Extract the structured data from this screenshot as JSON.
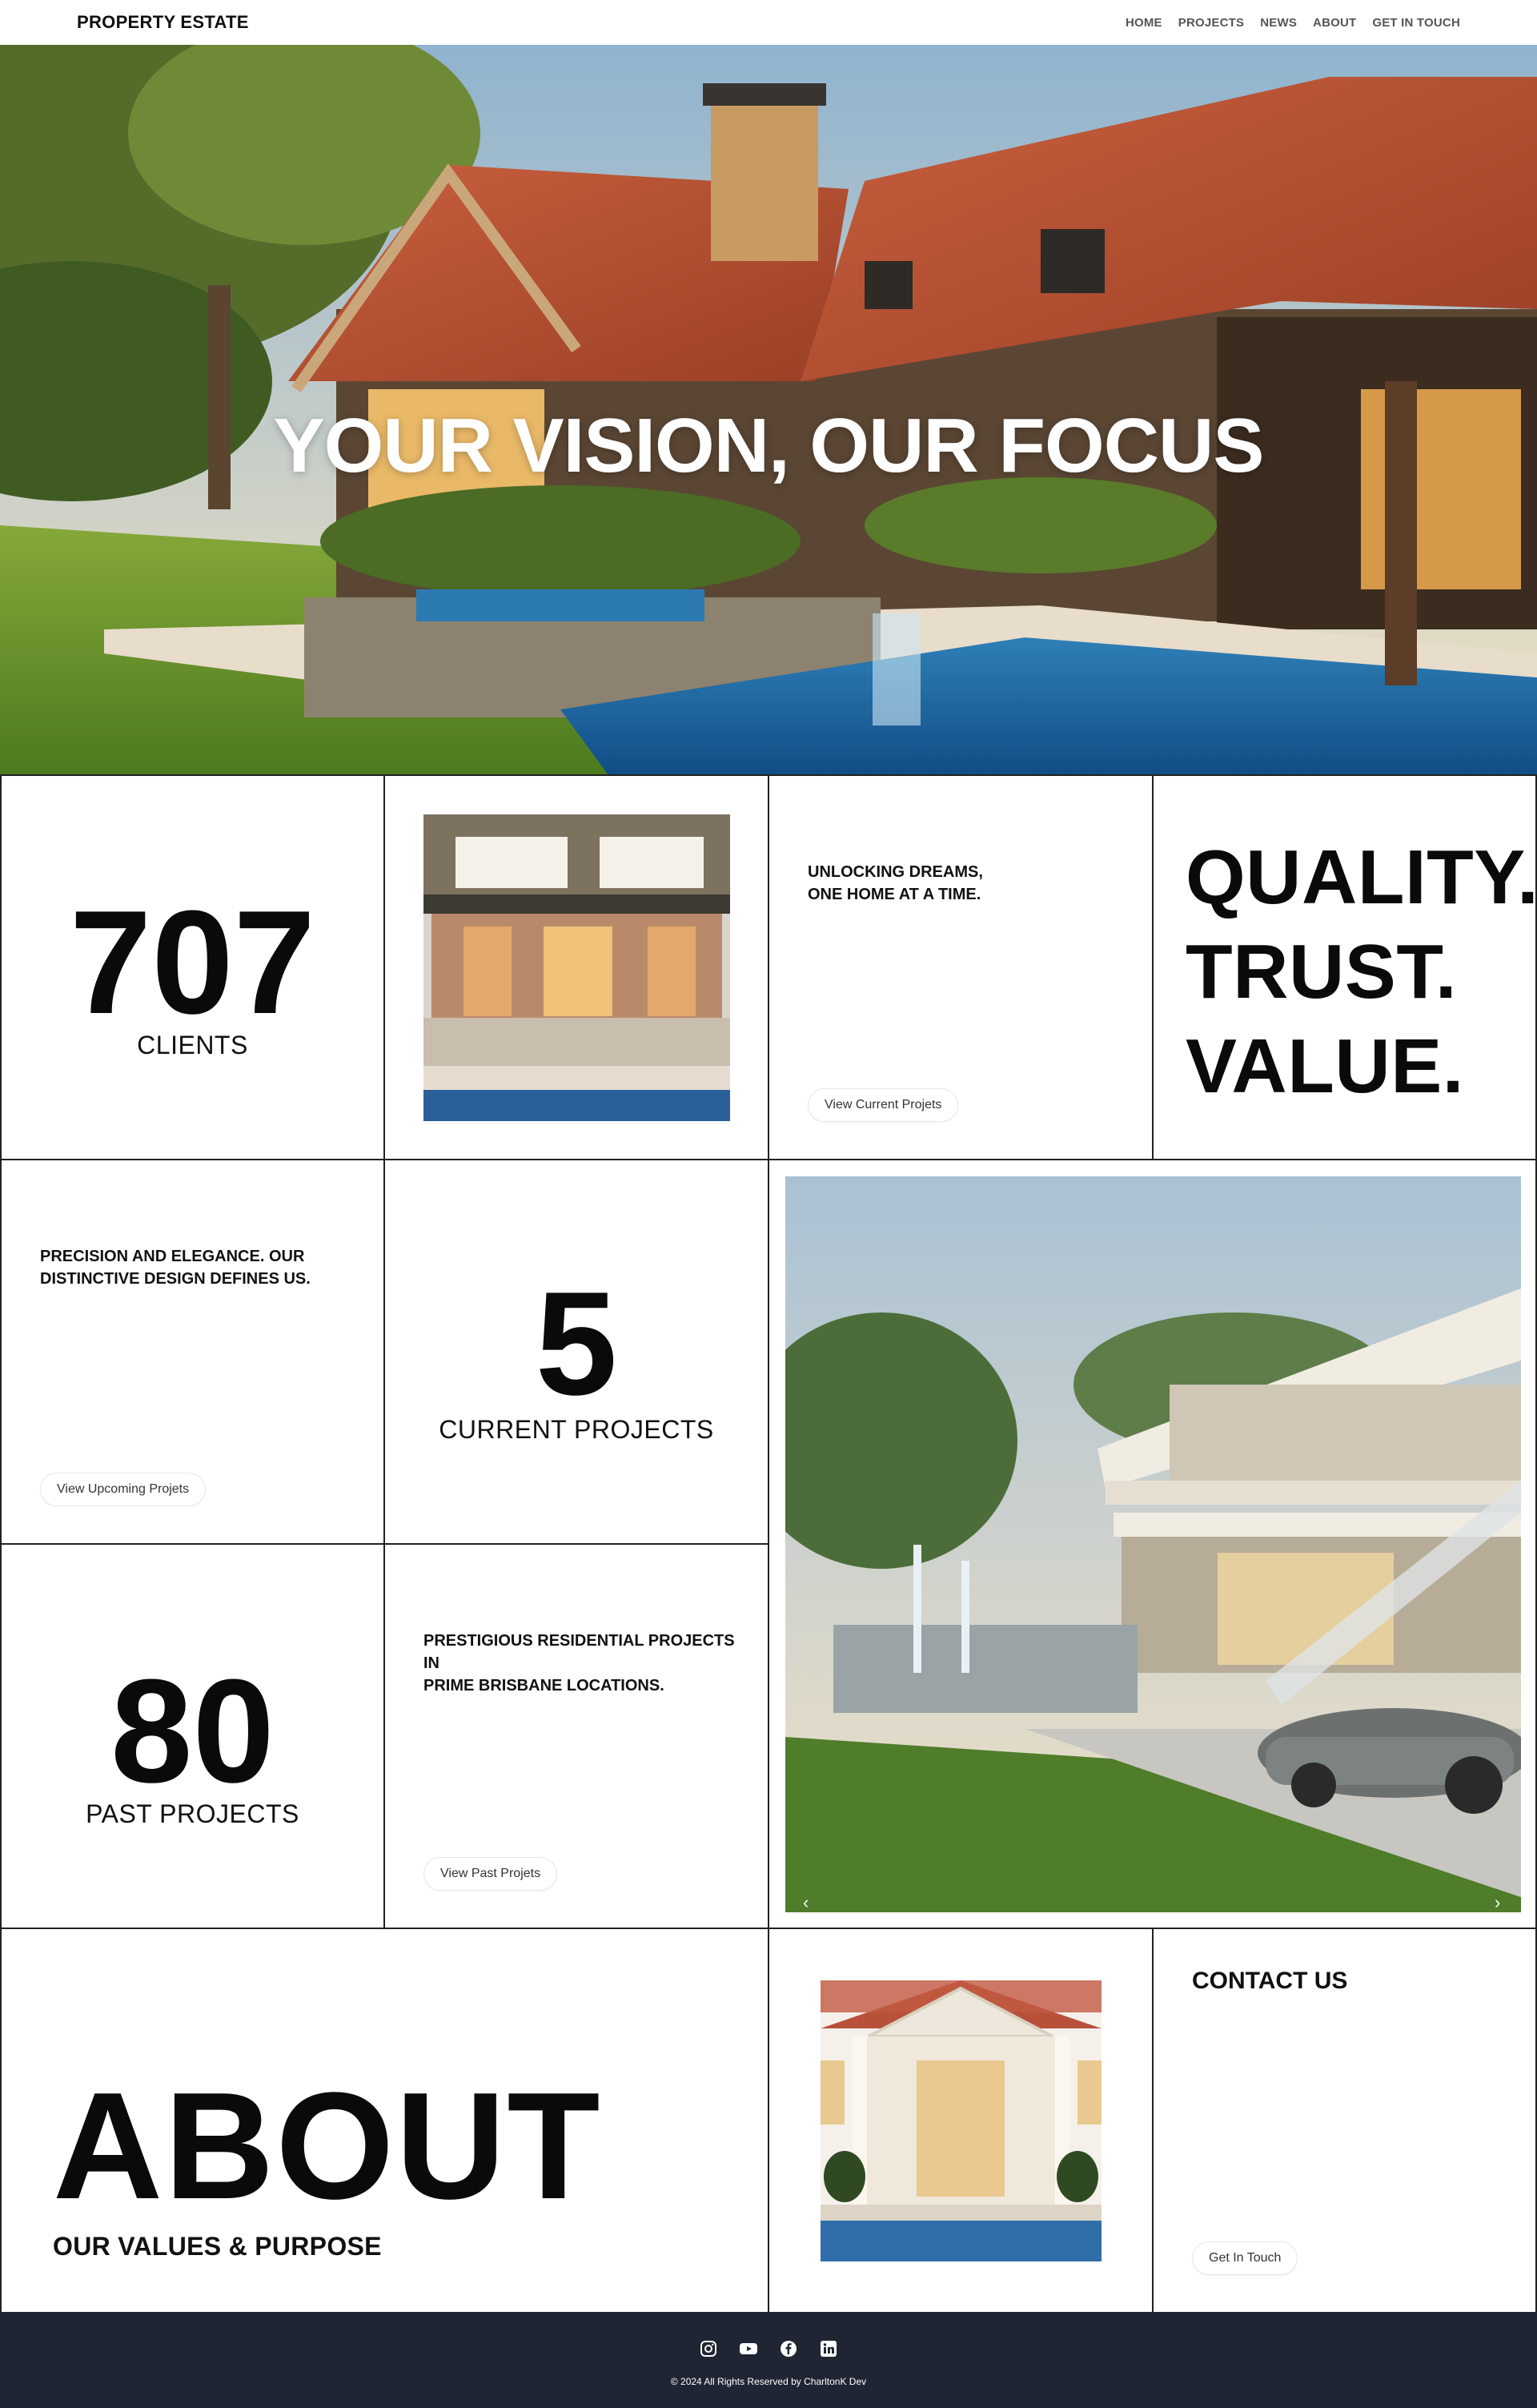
{
  "brand": "PROPERTY ESTATE",
  "nav": {
    "items": [
      "HOME",
      "PROJECTS",
      "NEWS",
      "ABOUT",
      "GET IN TOUCH"
    ]
  },
  "hero": {
    "title": "YOUR VISION, OUR FOCUS"
  },
  "stats": {
    "clients": {
      "value": "707",
      "label": "CLIENTS"
    },
    "current": {
      "value": "5",
      "label": "CURRENT PROJECTS"
    },
    "past": {
      "value": "80",
      "label": "PAST PROJECTS"
    }
  },
  "tagline_dreams": {
    "line1": "UNLOCKING DREAMS,",
    "line2": "ONE HOME AT A TIME.",
    "button": "View Current Projets"
  },
  "tagline_precision": {
    "line1": "PRECISION AND ELEGANCE. OUR",
    "line2": "DISTINCTIVE DESIGN DEFINES US.",
    "button": "View Upcoming Projets"
  },
  "tagline_prestigious": {
    "line1": "PRESTIGIOUS RESIDENTIAL PROJECTS IN",
    "line2": "PRIME BRISBANE LOCATIONS.",
    "button": "View Past Projets"
  },
  "quality": {
    "line1": "QUALITY.",
    "line2": "TRUST.",
    "line3": "VALUE."
  },
  "carousel": {
    "prev": "‹",
    "next": "›"
  },
  "about": {
    "title": "ABOUT",
    "subtitle": "OUR VALUES & PURPOSE"
  },
  "contact": {
    "title": "CONTACT US",
    "button": "Get In Touch"
  },
  "footer": {
    "socials": [
      "instagram-icon",
      "youtube-icon",
      "facebook-icon",
      "linkedin-icon"
    ],
    "copyright": "© 2024 All Rights Reserved by CharltonK Dev"
  },
  "colors": {
    "footer_bg": "#1f2532",
    "border": "#222222",
    "text": "#111111"
  }
}
